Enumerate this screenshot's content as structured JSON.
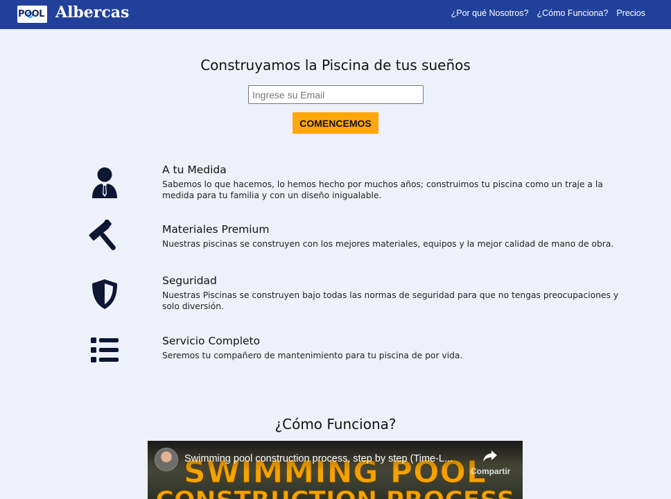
{
  "header": {
    "logo_text": "POOL",
    "brand": "Albercas",
    "nav": [
      {
        "label": "¿Por qué Nosotros?"
      },
      {
        "label": "¿Cómo Funciona?"
      },
      {
        "label": "Precios"
      }
    ]
  },
  "hero": {
    "title": "Construyamos la Piscina de tus sueños",
    "email_placeholder": "Ingrese su Email",
    "cta_label": "COMENCEMOS"
  },
  "features": [
    {
      "icon": "user-tie-icon",
      "title": "A tu Medida",
      "description": "Sabemos lo que hacemos, lo hemos hecho por muchos años; construimos tu piscina como un traje a la medida para tu familia y con un diseño inigualable."
    },
    {
      "icon": "hammer-icon",
      "title": "Materiales Premium",
      "description": "Nuestras piscinas se construyen con los mejores materiales, equipos y la mejor calidad de mano de obra."
    },
    {
      "icon": "shield-icon",
      "title": "Seguridad",
      "description": "Nuestras Piscinas se construyen bajo todas las normas de seguridad para que no tengas preocupaciones y solo diversión."
    },
    {
      "icon": "list-icon",
      "title": "Servicio Completo",
      "description": "Seremos tu compañero de mantenimiento para tu piscina de por vida."
    }
  ],
  "how_it_works": {
    "title": "¿Cómo Funciona?",
    "video": {
      "title": "Swimming pool construction process, step by step (Time-L...",
      "share_label": "Compartir",
      "thumbnail_text_1": "SWIMMING POOL",
      "thumbnail_text_2": "CONSTRUCTION PROCESS"
    }
  },
  "colors": {
    "header_bg": "#20409a",
    "page_bg": "#eef1f9",
    "cta_bg": "#ffa708",
    "icon_color": "#0d1633"
  }
}
